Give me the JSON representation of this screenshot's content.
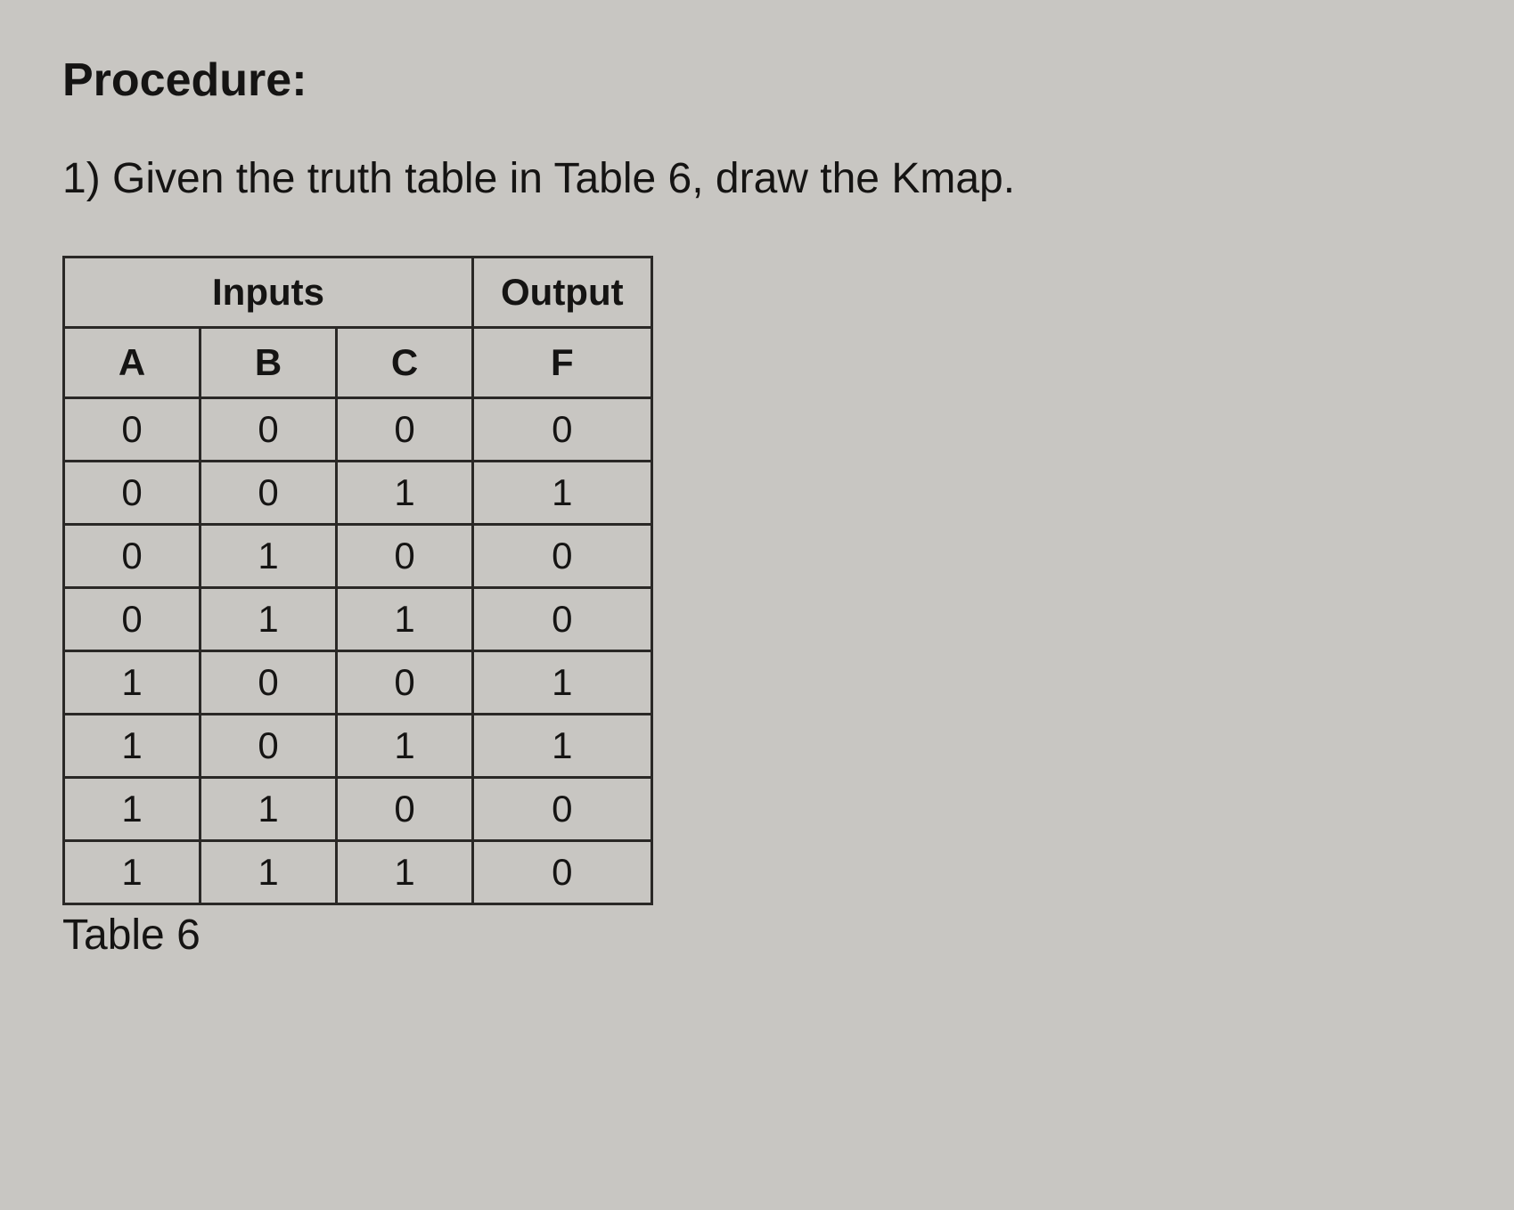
{
  "heading": "Procedure:",
  "instruction": "1) Given the truth table in Table 6, draw the Kmap.",
  "table": {
    "group_headers": {
      "inputs": "Inputs",
      "output": "Output"
    },
    "columns": [
      "A",
      "B",
      "C",
      "F"
    ],
    "rows": [
      {
        "A": "0",
        "B": "0",
        "C": "0",
        "F": "0"
      },
      {
        "A": "0",
        "B": "0",
        "C": "1",
        "F": "1"
      },
      {
        "A": "0",
        "B": "1",
        "C": "0",
        "F": "0"
      },
      {
        "A": "0",
        "B": "1",
        "C": "1",
        "F": "0"
      },
      {
        "A": "1",
        "B": "0",
        "C": "0",
        "F": "1"
      },
      {
        "A": "1",
        "B": "0",
        "C": "1",
        "F": "1"
      },
      {
        "A": "1",
        "B": "1",
        "C": "0",
        "F": "0"
      },
      {
        "A": "1",
        "B": "1",
        "C": "1",
        "F": "0"
      }
    ],
    "caption": "Table 6"
  }
}
